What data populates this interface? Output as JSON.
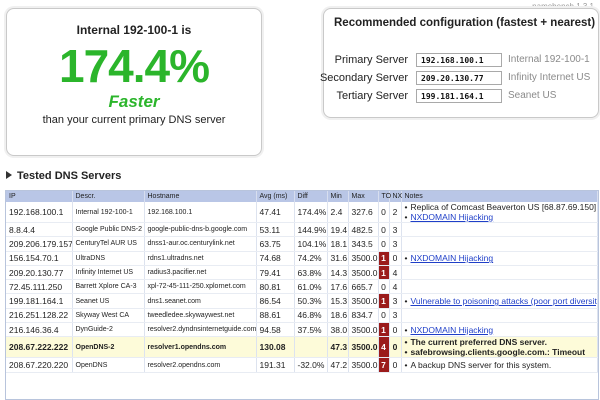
{
  "watermark": "namebench 1.3.1",
  "result": {
    "headline": "Internal 192-100-1 is",
    "percent": "174.4%",
    "faster": "Faster",
    "subtext": "than your current primary DNS server"
  },
  "config": {
    "title": "Recommended configuration (fastest + nearest)",
    "rows": [
      {
        "label": "Primary Server",
        "value": "192.168.100.1",
        "owner": "Internal 192-100-1"
      },
      {
        "label": "Secondary Server",
        "value": "209.20.130.77",
        "owner": "Infinity Internet US"
      },
      {
        "label": "Tertiary Server",
        "value": "199.181.164.1",
        "owner": "Seanet US"
      }
    ]
  },
  "section": {
    "title": "Tested DNS Servers"
  },
  "table": {
    "headers": [
      "IP",
      "Descr.",
      "Hostname",
      "Avg (ms)",
      "Diff",
      "Min",
      "Max",
      "TO",
      "NX",
      "Notes"
    ],
    "rows": [
      {
        "ip": "192.168.100.1",
        "descr": "Internal 192-100-1",
        "host": "192.168.100.1",
        "avg": "47.41",
        "diff": "174.4%",
        "min": "2.4",
        "max": "327.6",
        "to": "0",
        "nx": "2",
        "notes": [
          {
            "text": "Replica of Comcast Beaverton US [68.87.69.150]",
            "link": false
          },
          {
            "text": "NXDOMAIN Hijacking",
            "link": true
          }
        ],
        "bad_to": false,
        "preferred": false
      },
      {
        "ip": "8.8.4.4",
        "descr": "Google Public DNS-2",
        "host": "google-public-dns-b.google.com",
        "avg": "53.11",
        "diff": "144.9%",
        "min": "19.4",
        "max": "482.5",
        "to": "0",
        "nx": "3",
        "notes": [],
        "bad_to": false,
        "preferred": false
      },
      {
        "ip": "209.206.179.157",
        "descr": "CenturyTel AUR US",
        "host": "dnss1-aur.oc.centurylink.net",
        "avg": "63.75",
        "diff": "104.1%",
        "min": "18.1",
        "max": "343.5",
        "to": "0",
        "nx": "3",
        "notes": [],
        "bad_to": false,
        "preferred": false
      },
      {
        "ip": "156.154.70.1",
        "descr": "UltraDNS",
        "host": "rdns1.ultradns.net",
        "avg": "74.68",
        "diff": "74.2%",
        "min": "31.6",
        "max": "3500.0",
        "to": "1",
        "nx": "0",
        "notes": [
          {
            "text": "NXDOMAIN Hijacking",
            "link": true
          }
        ],
        "bad_to": true,
        "preferred": false
      },
      {
        "ip": "209.20.130.77",
        "descr": "Infinity Internet US",
        "host": "radius3.pacifier.net",
        "avg": "79.41",
        "diff": "63.8%",
        "min": "14.3",
        "max": "3500.0",
        "to": "1",
        "nx": "4",
        "notes": [],
        "bad_to": true,
        "preferred": false
      },
      {
        "ip": "72.45.111.250",
        "descr": "Barrett Xplore CA-3",
        "host": "xpl-72-45-111-250.xplornet.com",
        "avg": "80.81",
        "diff": "61.0%",
        "min": "17.6",
        "max": "665.7",
        "to": "0",
        "nx": "4",
        "notes": [],
        "bad_to": false,
        "preferred": false
      },
      {
        "ip": "199.181.164.1",
        "descr": "Seanet US",
        "host": "dns1.seanet.com",
        "avg": "86.54",
        "diff": "50.3%",
        "min": "15.3",
        "max": "3500.0",
        "to": "1",
        "nx": "3",
        "notes": [
          {
            "text": "Vulnerable to poisoning attacks (poor port diversity)",
            "link": true
          }
        ],
        "bad_to": true,
        "preferred": false
      },
      {
        "ip": "216.251.128.22",
        "descr": "Skyway West CA",
        "host": "tweedledee.skywaywest.net",
        "avg": "88.61",
        "diff": "46.8%",
        "min": "18.6",
        "max": "834.7",
        "to": "0",
        "nx": "3",
        "notes": [],
        "bad_to": false,
        "preferred": false
      },
      {
        "ip": "216.146.36.4",
        "descr": "DynGuide-2",
        "host": "resolver2.dyndnsinternetguide.com",
        "avg": "94.58",
        "diff": "37.5%",
        "min": "38.0",
        "max": "3500.0",
        "to": "1",
        "nx": "0",
        "notes": [
          {
            "text": "NXDOMAIN Hijacking",
            "link": true
          }
        ],
        "bad_to": true,
        "preferred": false
      },
      {
        "ip": "208.67.222.222",
        "descr": "OpenDNS-2",
        "host": "resolver1.opendns.com",
        "avg": "130.08",
        "diff": "",
        "min": "47.3",
        "max": "3500.0",
        "to": "4",
        "nx": "0",
        "notes": [
          {
            "text": "The current preferred DNS server.",
            "link": false
          },
          {
            "text": "safebrowsing.clients.google.com.: Timeout",
            "link": false
          }
        ],
        "bad_to": true,
        "preferred": true
      },
      {
        "ip": "208.67.220.220",
        "descr": "OpenDNS",
        "host": "resolver2.opendns.com",
        "avg": "191.31",
        "diff": "-32.0%",
        "min": "47.2",
        "max": "3500.0",
        "to": "7",
        "nx": "0",
        "notes": [
          {
            "text": "A backup DNS server for this system.",
            "link": false
          }
        ],
        "bad_to": true,
        "preferred": false
      }
    ]
  }
}
